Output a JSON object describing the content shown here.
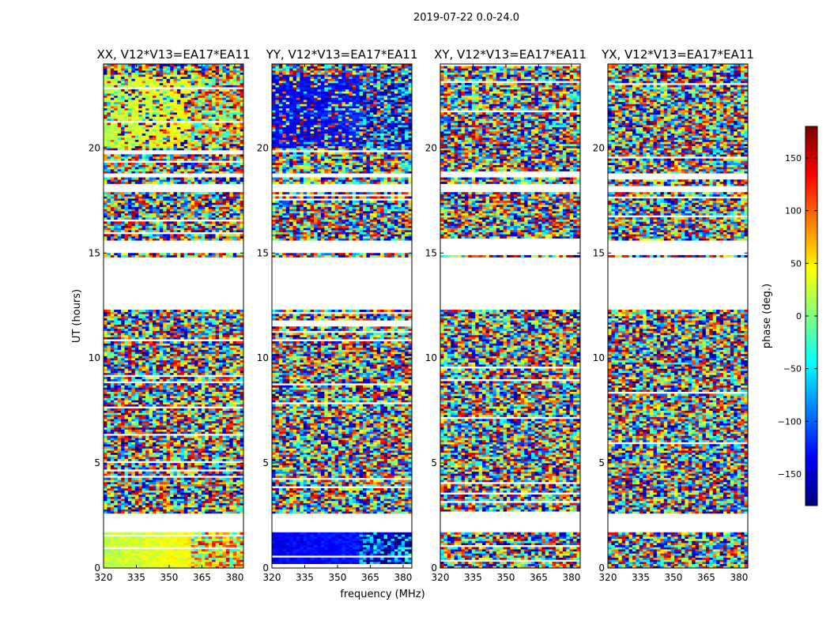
{
  "chart_data": {
    "type": "heatmap",
    "title": "2019-07-22 0.0-24.0",
    "xlabel": "frequency (MHz)",
    "ylabel": "UT (hours)",
    "xlim": [
      320,
      384
    ],
    "ylim": [
      0,
      24
    ],
    "xticks": [
      320,
      335,
      350,
      365,
      380
    ],
    "yticks": [
      0,
      5,
      10,
      15,
      20
    ],
    "colorbar": {
      "label": "phase (deg.)",
      "range": [
        -180,
        180
      ],
      "ticks": [
        -150,
        -100,
        -50,
        0,
        50,
        100,
        150
      ],
      "colormap": [
        "#00007f",
        "#0000ff",
        "#007fff",
        "#00ffff",
        "#7fff7f",
        "#ffff00",
        "#ff7f00",
        "#ff0000",
        "#7f0000"
      ]
    },
    "panels": [
      {
        "title": "XX, V12*V13=EA17*EA11",
        "pattern": "coherent",
        "low_phase": 20,
        "high_phase": 60
      },
      {
        "title": "YY, V12*V13=EA17*EA11",
        "pattern": "coherent",
        "low_phase": -140,
        "high_phase": -120
      },
      {
        "title": "XY, V12*V13=EA17*EA11",
        "pattern": "noise"
      },
      {
        "title": "YX, V12*V13=EA17*EA11",
        "pattern": "noise"
      }
    ],
    "flagged_ut_ranges": [
      [
        1.75,
        2.55
      ],
      [
        12.3,
        14.8
      ],
      [
        15.0,
        15.6
      ],
      [
        17.9,
        18.2
      ],
      [
        18.6,
        18.8
      ]
    ]
  }
}
